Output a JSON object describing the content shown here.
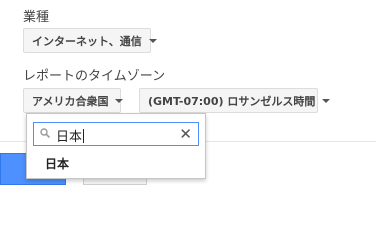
{
  "industry": {
    "label": "業種",
    "selected": "インターネット、通信"
  },
  "report_timezone": {
    "label": "レポートのタイムゾーン",
    "country_selected": "アメリカ合衆国",
    "timezone_selected": "(GMT-07:00) ロサンゼルス時間"
  },
  "country_dropdown": {
    "search_value": "日本",
    "results": [
      "日本"
    ]
  },
  "icons": {
    "search": "magnifier-icon",
    "clear": "close-icon",
    "dropdown": "caret-down-icon"
  },
  "colors": {
    "primary_button": "#4d90fe",
    "search_focus_border": "#4d90fe"
  }
}
